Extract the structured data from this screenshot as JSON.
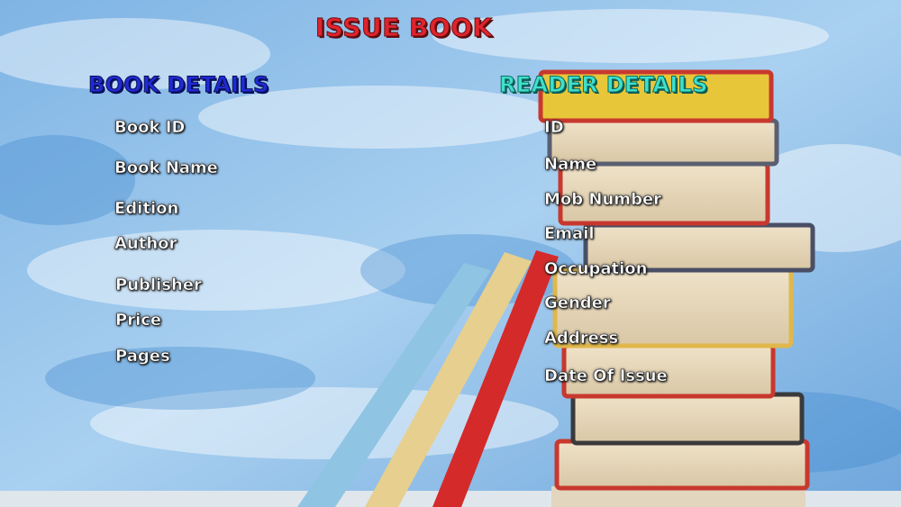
{
  "window": {
    "title": "ISSUE BOOK"
  },
  "book_section": {
    "heading": "BOOK DETAILS",
    "fields": [
      {
        "label": "Book ID"
      },
      {
        "label": "Book Name"
      },
      {
        "label": "Edition"
      },
      {
        "label": "Author"
      },
      {
        "label": "Publisher"
      },
      {
        "label": "Price"
      },
      {
        "label": "Pages"
      }
    ]
  },
  "reader_section": {
    "heading": "READER DETAILS",
    "fields": [
      {
        "label": "ID"
      },
      {
        "label": "Name"
      },
      {
        "label": "Mob Number"
      },
      {
        "label": "Email"
      },
      {
        "label": "Occupation"
      },
      {
        "label": "Gender"
      },
      {
        "label": "Address"
      },
      {
        "label": "Date Of Issue"
      }
    ]
  },
  "colors": {
    "title": "#e0242e",
    "book_heading": "#1f2bd6",
    "reader_heading": "#3fe0cc",
    "label": "#ffffff",
    "background": "#8bbde8"
  }
}
